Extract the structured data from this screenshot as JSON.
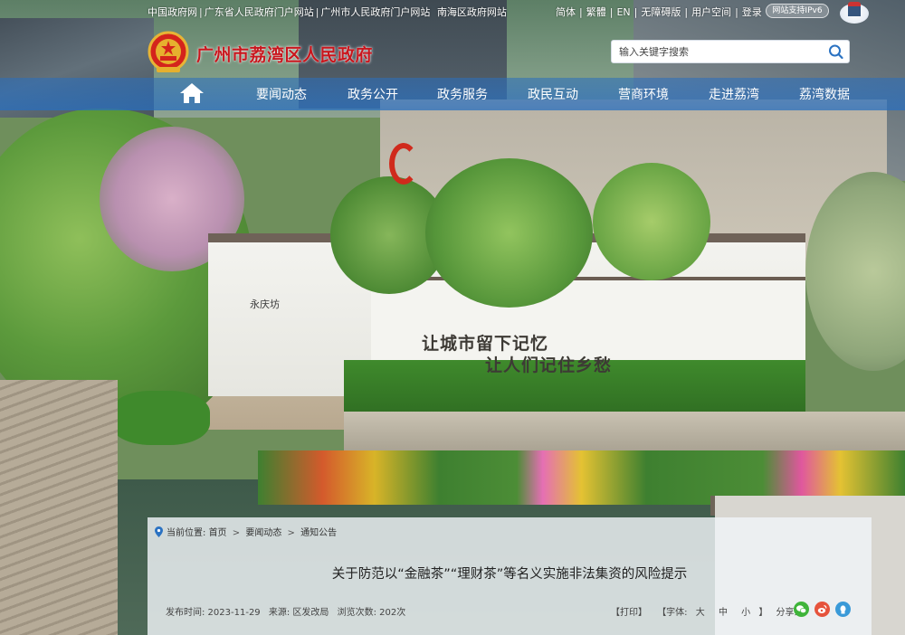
{
  "top_links": [
    {
      "label": "中国政府网"
    },
    {
      "label": "广东省人民政府门户网站"
    },
    {
      "label": "广州市人民政府门户网站"
    },
    {
      "label": "南海区政府网站"
    }
  ],
  "toolbar": {
    "simplified": "简体",
    "traditional": "繁體",
    "english": "EN",
    "accessible": "无障碍版",
    "user_space": "用户空间",
    "login": "登录",
    "ipv6": "网站支持IPv6"
  },
  "header": {
    "site_title": "广州市荔湾区人民政府",
    "search_placeholder": "输入关键字搜索"
  },
  "nav": {
    "items": [
      {
        "label": "要闻动态"
      },
      {
        "label": "政务公开"
      },
      {
        "label": "政务服务"
      },
      {
        "label": "政民互动"
      },
      {
        "label": "营商环境"
      },
      {
        "label": "走进荔湾"
      },
      {
        "label": "荔湾数据"
      }
    ]
  },
  "banner": {
    "slogan_line1": "让城市留下记忆",
    "slogan_line2": "让人们记住乡愁",
    "gate_plaque": "永庆坊"
  },
  "breadcrumb": {
    "prefix": "当前位置:",
    "items": [
      {
        "label": "首页"
      },
      {
        "label": "要闻动态"
      },
      {
        "label": "通知公告"
      }
    ],
    "separator": ">"
  },
  "article": {
    "title": "关于防范以“金融茶”“理财茶”等名义实施非法集资的风险提示",
    "publish_time": "发布时间: 2023-11-29",
    "source": "来源: 区发改局",
    "views": "浏览次数: 202次",
    "print": "【打印】",
    "font_label": "【字体:",
    "font_large": "大",
    "font_medium": "中",
    "font_small": "小",
    "font_close": "】",
    "share_label": "分享到:"
  },
  "colors": {
    "title_red": "#c8161d",
    "nav_blue": "#286ebe",
    "wechat": "#3fb43a",
    "weibo": "#e6533c",
    "qzone": "#3a9ad8"
  },
  "icons": [
    "home-icon",
    "search-icon",
    "location-pin-icon",
    "wechat-icon",
    "weibo-icon",
    "qzone-icon",
    "national-emblem-icon"
  ]
}
